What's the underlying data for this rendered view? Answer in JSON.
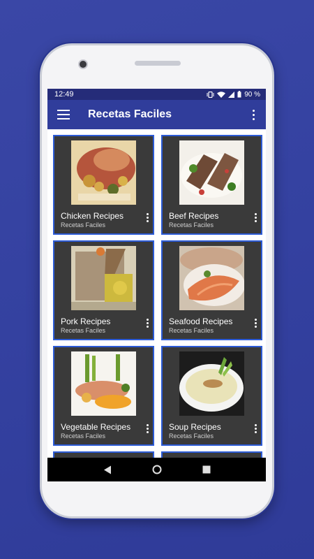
{
  "status": {
    "time": "12:49",
    "battery": "90 %"
  },
  "app": {
    "title": "Recetas Faciles"
  },
  "icons": {
    "menu": "hamburger-menu-icon",
    "overflow": "more-vertical-icon",
    "back": "back-triangle-icon",
    "home": "home-circle-icon",
    "recents": "recents-square-icon"
  },
  "cards": [
    {
      "title": "Chicken Recipes",
      "subtitle": "Recetas Faciles"
    },
    {
      "title": "Beef Recipes",
      "subtitle": "Recetas Faciles"
    },
    {
      "title": "Pork Recipes",
      "subtitle": "Recetas Faciles"
    },
    {
      "title": "Seafood Recipes",
      "subtitle": "Recetas Faciles"
    },
    {
      "title": "Vegetable Recipes",
      "subtitle": "Recetas Faciles"
    },
    {
      "title": "Soup Recipes",
      "subtitle": "Recetas Faciles"
    }
  ],
  "colors": {
    "background": "#3441a0",
    "appbar": "#303d9b",
    "statusbar": "#252c79",
    "card": "#3a3a3a",
    "card_border": "#2c5bd6"
  }
}
